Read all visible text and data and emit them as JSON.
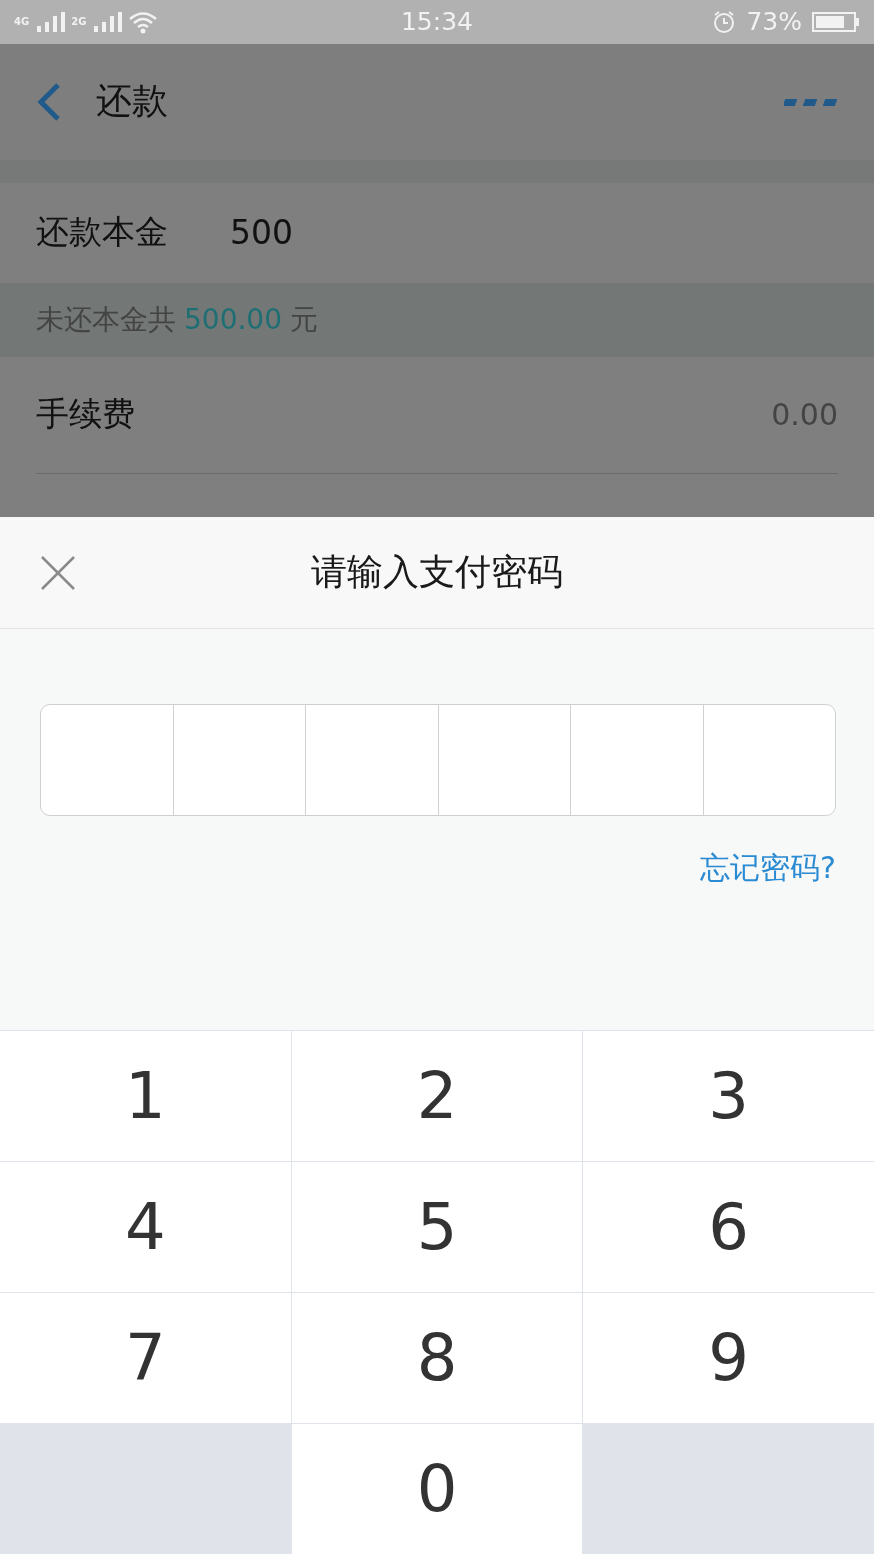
{
  "status_bar": {
    "network_1": "4G",
    "network_2": "2G",
    "time": "15:34",
    "battery": "73%"
  },
  "header": {
    "title": "还款"
  },
  "form": {
    "principal": {
      "label": "还款本金",
      "value": "500"
    },
    "hint": {
      "prefix": "未还本金共",
      "amount": "500.00",
      "suffix": "元"
    },
    "fee": {
      "label": "手续费",
      "value": "0.00"
    }
  },
  "sheet": {
    "title": "请输入支付密码",
    "password_cells": [
      {
        "filled": false
      },
      {
        "filled": false
      },
      {
        "filled": false
      },
      {
        "filled": false
      },
      {
        "filled": false
      },
      {
        "filled": false
      }
    ],
    "forgot_link": "忘记密码?"
  },
  "keypad": [
    {
      "kind": "digit",
      "label": "1"
    },
    {
      "kind": "digit",
      "label": "2"
    },
    {
      "kind": "digit",
      "label": "3"
    },
    {
      "kind": "digit",
      "label": "4"
    },
    {
      "kind": "digit",
      "label": "5"
    },
    {
      "kind": "digit",
      "label": "6"
    },
    {
      "kind": "digit",
      "label": "7"
    },
    {
      "kind": "digit",
      "label": "8"
    },
    {
      "kind": "digit",
      "label": "9"
    },
    {
      "kind": "blank"
    },
    {
      "kind": "digit",
      "label": "0"
    },
    {
      "kind": "blank"
    }
  ]
}
